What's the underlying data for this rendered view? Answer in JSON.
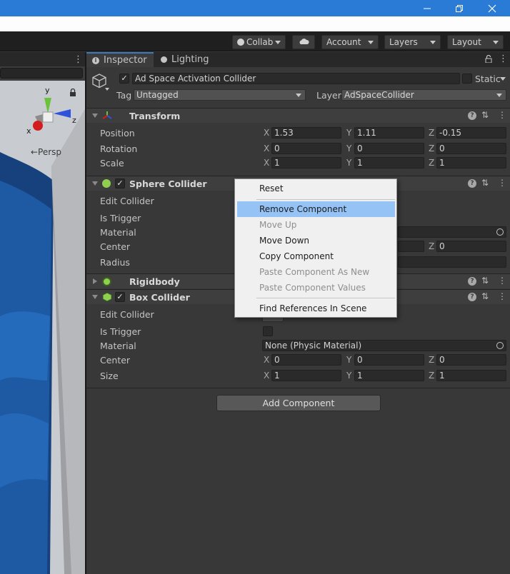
{
  "window": {
    "controls": {
      "minimize_icon": "minimize-icon",
      "restore_icon": "restore-icon",
      "close_icon": "close-icon"
    }
  },
  "toolbar": {
    "collab_label": "Collab",
    "account_label": "Account",
    "layers_label": "Layers",
    "layout_label": "Layout"
  },
  "scene": {
    "persp_label": "←Persp",
    "gizmo": {
      "x": "x",
      "y": "y",
      "z": "z"
    }
  },
  "inspector": {
    "tabs": [
      {
        "label": "Inspector",
        "icon": "info-icon"
      },
      {
        "label": "Lighting",
        "icon": "bulb-icon"
      }
    ],
    "object": {
      "name": "Ad Space Activation Collider",
      "active": true,
      "static_label": "Static",
      "tag_label": "Tag",
      "tag_value": "Untagged",
      "layer_label": "Layer",
      "layer_value": "AdSpaceCollider"
    },
    "transform": {
      "title": "Transform",
      "position_label": "Position",
      "rotation_label": "Rotation",
      "scale_label": "Scale",
      "axis_x": "X",
      "axis_y": "Y",
      "axis_z": "Z",
      "position": {
        "x": "1.53",
        "y": "1.11",
        "z": "-0.15"
      },
      "rotation": {
        "x": "0",
        "y": "0",
        "z": "0"
      },
      "scale": {
        "x": "1",
        "y": "1",
        "z": "1"
      }
    },
    "sphere_collider": {
      "title": "Sphere Collider",
      "edit_collider": "Edit Collider",
      "is_trigger": "Is Trigger",
      "material": "Material",
      "center": "Center",
      "radius": "Radius",
      "center_z": "0"
    },
    "rigidbody": {
      "title": "Rigidbody"
    },
    "box_collider": {
      "title": "Box Collider",
      "edit_collider": "Edit Collider",
      "is_trigger": "Is Trigger",
      "material": "Material",
      "material_value": "None (Physic Material)",
      "center": "Center",
      "size": "Size",
      "center_values": {
        "x": "0",
        "y": "0",
        "z": "0"
      },
      "size_values": {
        "x": "1",
        "y": "1",
        "z": "1"
      }
    },
    "add_component_label": "Add Component"
  },
  "context_menu": {
    "items": [
      {
        "label": "Reset",
        "enabled": true
      },
      {
        "label": "Remove Component",
        "enabled": true,
        "highlighted": true
      },
      {
        "label": "Move Up",
        "enabled": false
      },
      {
        "label": "Move Down",
        "enabled": true
      },
      {
        "label": "Copy Component",
        "enabled": true
      },
      {
        "label": "Paste Component As New",
        "enabled": false
      },
      {
        "label": "Paste Component Values",
        "enabled": false
      },
      {
        "label": "Find References In Scene",
        "enabled": true
      }
    ]
  },
  "colors": {
    "titlebar": "#2a7bd6",
    "panel_bg": "#383838",
    "menu_highlight": "#96c3f5"
  }
}
